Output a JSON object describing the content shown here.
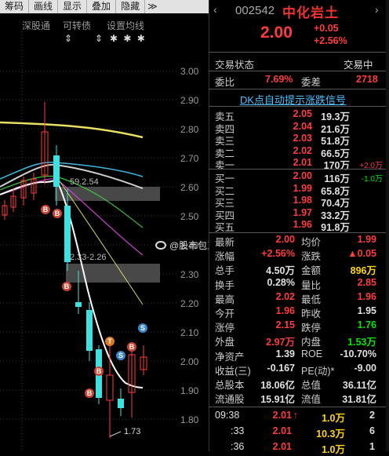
{
  "toolbar": {
    "items": [
      "筹码",
      "画线",
      "显示",
      "叠加",
      "隐藏"
    ],
    "more": "≫"
  },
  "indicators": {
    "labels": [
      "深股通",
      "可转债",
      "设置均线"
    ],
    "marks": [
      "⇕",
      "⇕",
      "✱ ✱ ✱"
    ]
  },
  "price_axis": [
    "3.00",
    "2.90",
    "2.80",
    "2.70",
    "2.60",
    "2.50",
    "2.40",
    "2.30",
    "2.20",
    "2.10",
    "2.00",
    "1.90",
    "1.80"
  ],
  "annotations": {
    "box1": "59.2.54",
    "box2": "2.33-2.26",
    "low": "1.73",
    "b_markers": [
      "B",
      "B",
      "B",
      "B",
      "B",
      "B"
    ],
    "s_markers": [
      "S",
      "S",
      "S"
    ],
    "t_marker": "T"
  },
  "watermark": "@股市包工头",
  "header": {
    "code": "002542",
    "name": "中化岩土",
    "price": "2.00",
    "change": "+0.05",
    "change_pct": "+2.56%"
  },
  "status": {
    "label": "交易状态",
    "value": "交易中"
  },
  "ratio": {
    "wb_label": "委比",
    "wb_value": "7.69%",
    "wc_label": "委差",
    "wc_value": "2718"
  },
  "dk_banner": "DK点自动提示涨跌信号",
  "asks": [
    {
      "label": "卖五",
      "price": "2.05",
      "vol": "19.3万",
      "chg": ""
    },
    {
      "label": "卖四",
      "price": "2.04",
      "vol": "21.6万",
      "chg": ""
    },
    {
      "label": "卖三",
      "price": "2.03",
      "vol": "51.8万",
      "chg": ""
    },
    {
      "label": "卖二",
      "price": "2.02",
      "vol": "66.5万",
      "chg": ""
    },
    {
      "label": "卖一",
      "price": "2.01",
      "vol": "170万",
      "chg": "+2.0万"
    }
  ],
  "bids": [
    {
      "label": "买一",
      "price": "2.00",
      "vol": "116万",
      "chg": "-1.0万"
    },
    {
      "label": "买二",
      "price": "1.99",
      "vol": "65.8万",
      "chg": ""
    },
    {
      "label": "买三",
      "price": "1.98",
      "vol": "70.4万",
      "chg": ""
    },
    {
      "label": "买四",
      "price": "1.97",
      "vol": "33.2万",
      "chg": ""
    },
    {
      "label": "买五",
      "price": "1.96",
      "vol": "91.8万",
      "chg": ""
    }
  ],
  "stats": [
    {
      "l1": "最新",
      "v1": "2.00",
      "c1": "red",
      "l2": "均价",
      "v2": "1.99",
      "c2": "red"
    },
    {
      "l1": "涨幅",
      "v1": "+2.56%",
      "c1": "red",
      "l2": "涨跌",
      "v2": "▲0.05",
      "c2": "red"
    },
    {
      "l1": "总手",
      "v1": "4.50万",
      "c1": "white",
      "l2": "金额",
      "v2": "896万",
      "c2": "yellow"
    },
    {
      "l1": "换手",
      "v1": "0.28%",
      "c1": "white",
      "l2": "量比",
      "v2": "2.85",
      "c2": "red"
    },
    {
      "l1": "最高",
      "v1": "2.02",
      "c1": "red",
      "l2": "最低",
      "v2": "1.96",
      "c2": "red"
    },
    {
      "l1": "今开",
      "v1": "1.96",
      "c1": "red",
      "l2": "昨收",
      "v2": "1.95",
      "c2": "white"
    },
    {
      "l1": "涨停",
      "v1": "2.15",
      "c1": "red",
      "l2": "跌停",
      "v2": "1.76",
      "c2": "green"
    },
    {
      "l1": "外盘",
      "v1": "2.97万",
      "c1": "red",
      "l2": "内盘",
      "v2": "1.53万",
      "c2": "green"
    },
    {
      "l1": "净资产",
      "v1": "1.39",
      "c1": "white",
      "l2": "ROE",
      "v2": "-10.70%",
      "c2": "white"
    },
    {
      "l1": "收益(三)",
      "v1": "-0.167",
      "c1": "white",
      "l2": "PE(动)*",
      "v2": "-9.00",
      "c2": "white"
    },
    {
      "l1": "总股本",
      "v1": "18.06亿",
      "c1": "white",
      "l2": "总值",
      "v2": "36.11亿",
      "c2": "white"
    },
    {
      "l1": "流通股",
      "v1": "15.91亿",
      "c1": "white",
      "l2": "流值",
      "v2": "31.81亿",
      "c2": "white"
    }
  ],
  "ticks": [
    {
      "time": "09:38",
      "price": "2.01",
      "arrow": "↑",
      "vol": "1.0万",
      "num": "2"
    },
    {
      "time": ":33",
      "price": "2.01",
      "arrow": "",
      "vol": "10.3万",
      "num": "6"
    },
    {
      "time": ":36",
      "price": "2.01",
      "arrow": "",
      "vol": "1.0万",
      "num": "1"
    }
  ],
  "colors": {
    "up": "#ff3c3c",
    "down": "#00e600",
    "ma_yellow": "#e8e060",
    "ma_white": "#d8d8d8"
  }
}
